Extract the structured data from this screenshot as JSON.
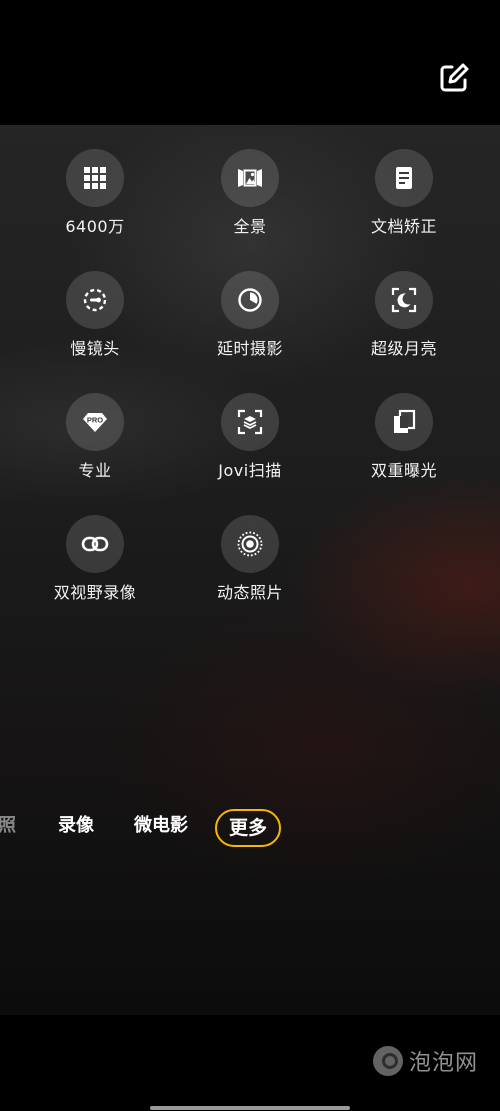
{
  "header": {
    "edit_icon": "edit-square-icon"
  },
  "modes": [
    {
      "label": "6400万",
      "icon": "grid-icon"
    },
    {
      "label": "全景",
      "icon": "panorama-icon"
    },
    {
      "label": "文档矫正",
      "icon": "document-icon"
    },
    {
      "label": "慢镜头",
      "icon": "slow-motion-icon"
    },
    {
      "label": "延时摄影",
      "icon": "timelapse-icon"
    },
    {
      "label": "超级月亮",
      "icon": "moon-icon"
    },
    {
      "label": "专业",
      "icon": "pro-icon",
      "icon_text": "PRO"
    },
    {
      "label": "Jovi扫描",
      "icon": "scan-icon"
    },
    {
      "label": "双重曝光",
      "icon": "double-exposure-icon"
    },
    {
      "label": "双视野录像",
      "icon": "dual-view-icon"
    },
    {
      "label": "动态照片",
      "icon": "live-photo-icon"
    }
  ],
  "tabs": {
    "partial": "照",
    "video": "录像",
    "micro_movie": "微电影",
    "more": "更多",
    "active": "更多",
    "active_color": "#f5b800"
  },
  "watermark": {
    "text": "泡泡网",
    "icon": "paopao-logo-icon"
  }
}
